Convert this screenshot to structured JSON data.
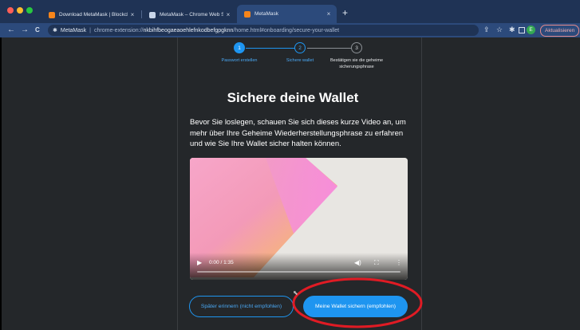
{
  "browser": {
    "tabs": [
      {
        "label": "Download MetaMask | Blockcha",
        "close": "×"
      },
      {
        "label": "MetaMask – Chrome Web Store",
        "close": "×"
      },
      {
        "label": "MetaMask",
        "close": "×"
      }
    ],
    "new_tab": "+",
    "nav": {
      "back": "←",
      "forward": "→",
      "reload": "C"
    },
    "address": {
      "site_name": "MetaMask",
      "url_prefix": "chrome-extension://",
      "url_host": "nkbihfbeogaeaoehlefnkodbefgpgknn",
      "url_path": "/home.html#onboarding/secure-your-wallet"
    },
    "profile_initial": "E",
    "update_label": "Aktualisieren"
  },
  "stepper": {
    "steps": [
      {
        "number": "1",
        "label": "Passwort erstellen"
      },
      {
        "number": "2",
        "label": "Sichere wallet"
      },
      {
        "number": "3",
        "label": "Bestätigen sie die geheime sicherungsphrase"
      }
    ]
  },
  "main": {
    "title": "Sichere deine Wallet",
    "description": "Bevor Sie loslegen, schauen Sie sich dieses kurze Video an, um mehr über Ihre Geheime Wiederherstellungsphrase zu erfahren und wie Sie Ihre Wallet sicher halten können."
  },
  "video": {
    "time": "0:00 / 1:35",
    "progress": 0
  },
  "buttons": {
    "later": "Später erinnern (nicht empfohlen)",
    "secure": "Meine Wallet sichern (empfohlen)"
  },
  "colors": {
    "accent": "#1e95f0",
    "page_bg": "#24272a",
    "annotation": "#e01b24"
  }
}
